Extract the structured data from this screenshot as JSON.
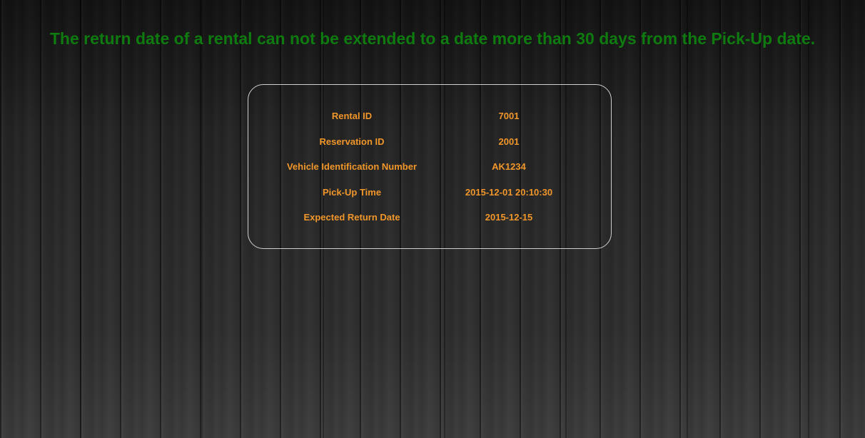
{
  "message": {
    "text": "The return date of a rental can not be extended to a date more than 30 days from the Pick-Up date.",
    "color": "#0f7a0f"
  },
  "details": {
    "text_color": "#f0962a",
    "rows": [
      {
        "label": "Rental ID",
        "value": "7001"
      },
      {
        "label": "Reservation ID",
        "value": "2001"
      },
      {
        "label": "Vehicle Identification Number",
        "value": "AK1234"
      },
      {
        "label": "Pick-Up Time",
        "value": "2015-12-01 20:10:30"
      },
      {
        "label": "Expected Return Date",
        "value": "2015-12-15"
      }
    ]
  }
}
